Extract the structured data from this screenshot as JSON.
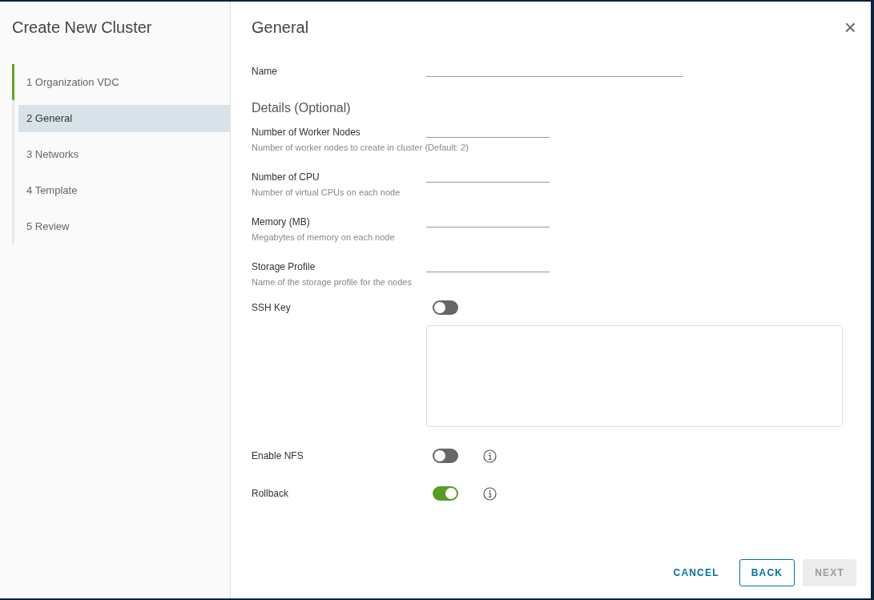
{
  "wizard": {
    "title": "Create New Cluster",
    "steps": [
      {
        "number": "1",
        "label": "Organization VDC",
        "completed": true,
        "selected": false
      },
      {
        "number": "2",
        "label": "General",
        "completed": false,
        "selected": true
      },
      {
        "number": "3",
        "label": "Networks",
        "completed": false,
        "selected": false
      },
      {
        "number": "4",
        "label": "Template",
        "completed": false,
        "selected": false
      },
      {
        "number": "5",
        "label": "Review",
        "completed": false,
        "selected": false
      }
    ]
  },
  "page": {
    "title": "General",
    "close": "×"
  },
  "name_field": {
    "label": "Name"
  },
  "details": {
    "heading": "Details (Optional)",
    "fields": [
      {
        "label": "Number of Worker Nodes",
        "hint": "Number of worker nodes to create in cluster (Default: 2)"
      },
      {
        "label": "Number of CPU",
        "hint": "Number of virtual CPUs on each node"
      },
      {
        "label": "Memory (MB)",
        "hint": "Megabytes of memory on each node"
      },
      {
        "label": "Storage Profile",
        "hint": "Name of the storage profile for the nodes"
      }
    ]
  },
  "ssh_key": {
    "label": "SSH Key",
    "on": false
  },
  "options": [
    {
      "label": "Enable NFS",
      "on": false
    },
    {
      "label": "Rollback",
      "on": true
    }
  ],
  "buttons": [
    {
      "label": "CANCEL",
      "kind": "flat",
      "disabled": false
    },
    {
      "label": "BACK",
      "kind": "outline",
      "disabled": false
    },
    {
      "label": "NEXT",
      "kind": "solid",
      "disabled": true
    }
  ]
}
